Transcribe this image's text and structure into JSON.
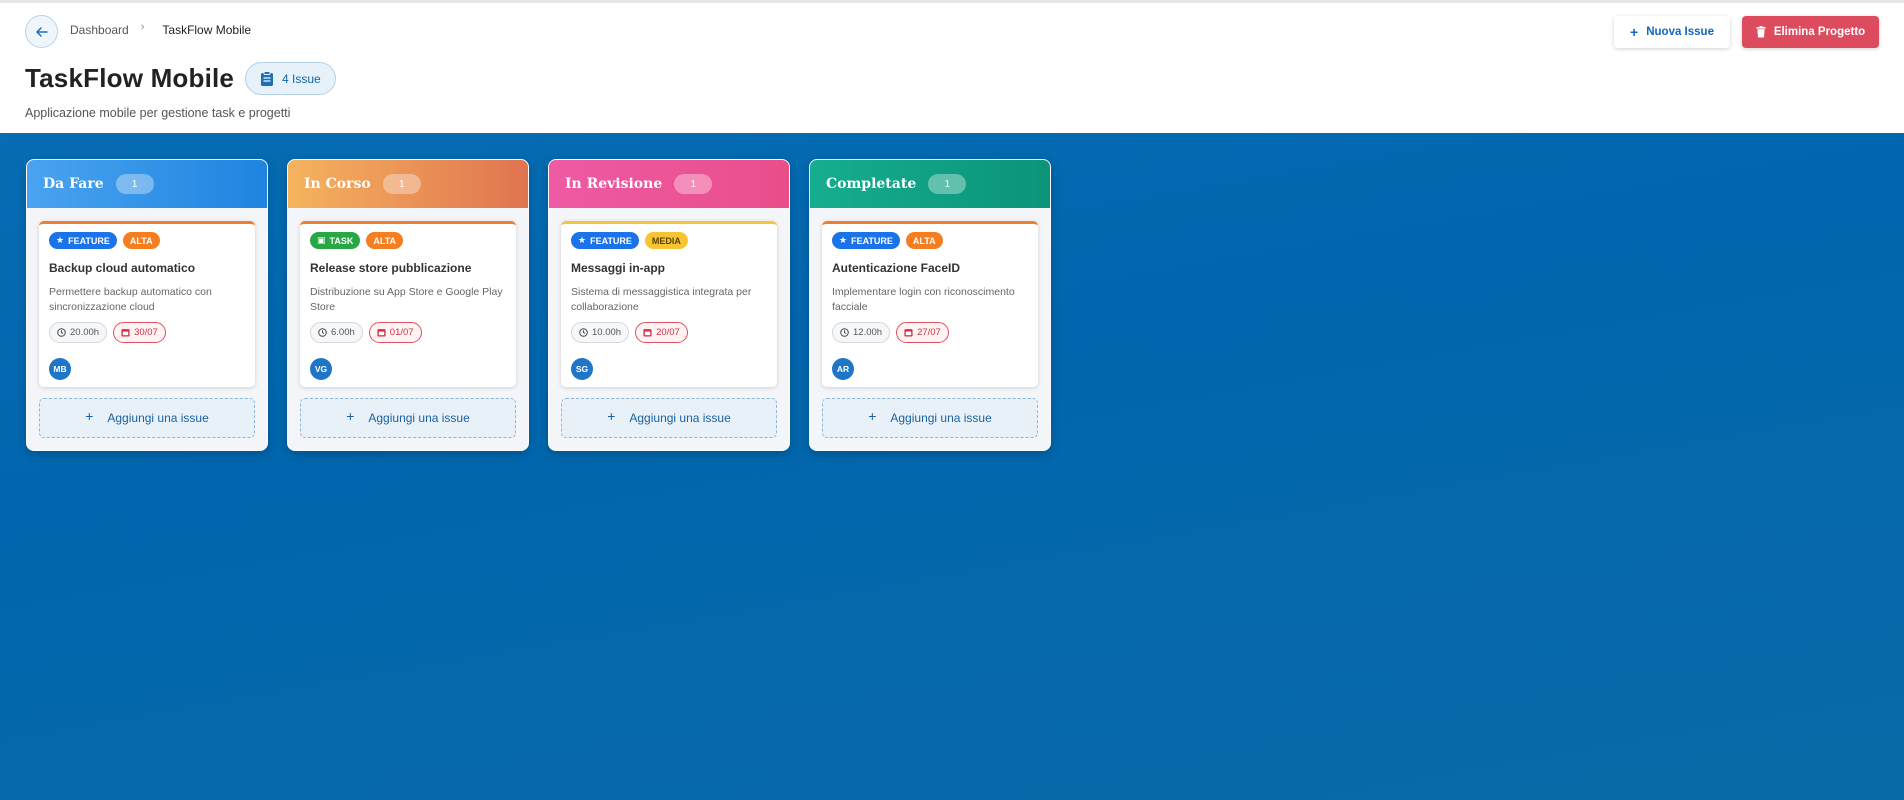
{
  "breadcrumb": {
    "root": "Dashboard",
    "current": "TaskFlow Mobile"
  },
  "project": {
    "title": "TaskFlow Mobile",
    "issue_count_label": "4 Issue",
    "description": "Applicazione mobile per gestione task e progetti"
  },
  "actions": {
    "new_issue": "Nuova Issue",
    "delete_project": "Elimina Progetto"
  },
  "colors": {
    "accent": "#1565c0",
    "danger": "#dc4b5e",
    "todo": "#2b8ce6",
    "in_progress": "#ea8a52",
    "review": "#ec4f96",
    "done": "#11a083"
  },
  "add_issue_label": "Aggiungi una issue",
  "columns": [
    {
      "title": "Da Fare",
      "count": "1",
      "card": {
        "type": "FEATURE",
        "priority": "ALTA",
        "title": "Backup cloud automatico",
        "description": "Permettere backup automatico con sincronizzazione cloud",
        "hours": "20.00h",
        "due": "30/07",
        "assignee": "MB"
      }
    },
    {
      "title": "In Corso",
      "count": "1",
      "card": {
        "type": "TASK",
        "priority": "ALTA",
        "title": "Release store pubblicazione",
        "description": "Distribuzione su App Store e Google Play Store",
        "hours": "6.00h",
        "due": "01/07",
        "assignee": "VG"
      }
    },
    {
      "title": "In Revisione",
      "count": "1",
      "card": {
        "type": "FEATURE",
        "priority": "MEDIA",
        "title": "Messaggi in-app",
        "description": "Sistema di messaggistica integrata per collaborazione",
        "hours": "10.00h",
        "due": "20/07",
        "assignee": "SG"
      }
    },
    {
      "title": "Completate",
      "count": "1",
      "card": {
        "type": "FEATURE",
        "priority": "ALTA",
        "title": "Autenticazione FaceID",
        "description": "Implementare login con riconoscimento facciale",
        "hours": "12.00h",
        "due": "27/07",
        "assignee": "AR"
      }
    }
  ]
}
